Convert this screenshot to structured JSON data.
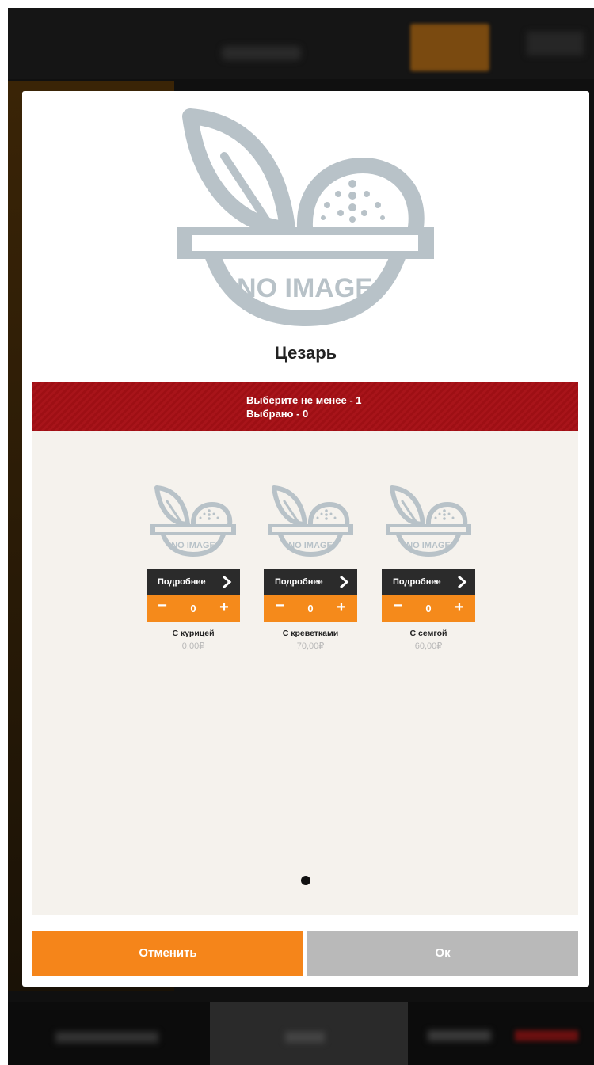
{
  "modal": {
    "title": "Цезарь",
    "hero_image_text": "NO IMAGE",
    "requirement": {
      "min_text": "Выберите не менее - 1",
      "selected_text": "Выбрано - 0"
    },
    "options": [
      {
        "thumb_text": "NO IMAGE",
        "more_label": "Подробнее",
        "minus": "−",
        "quantity": "0",
        "plus": "+",
        "name": "С курицей",
        "price": "0,00₽"
      },
      {
        "thumb_text": "NO IMAGE",
        "more_label": "Подробнее",
        "minus": "−",
        "quantity": "0",
        "plus": "+",
        "name": "С креветками",
        "price": "70,00₽"
      },
      {
        "thumb_text": "NO IMAGE",
        "more_label": "Подробнее",
        "minus": "−",
        "quantity": "0",
        "plus": "+",
        "name": "С семгой",
        "price": "60,00₽"
      }
    ],
    "cancel_label": "Отменить",
    "ok_label": "Ок"
  },
  "colors": {
    "accent_orange": "#f58a1b",
    "banner_red": "#9e0f14",
    "dark_button": "#2b2b2b",
    "disabled_gray": "#b9b9b9",
    "placeholder_gray": "#b8c2c8"
  },
  "icons": [
    "no-image-bowl-icon",
    "chevron-right-icon",
    "minus-icon",
    "plus-icon",
    "page-dot-icon"
  ]
}
